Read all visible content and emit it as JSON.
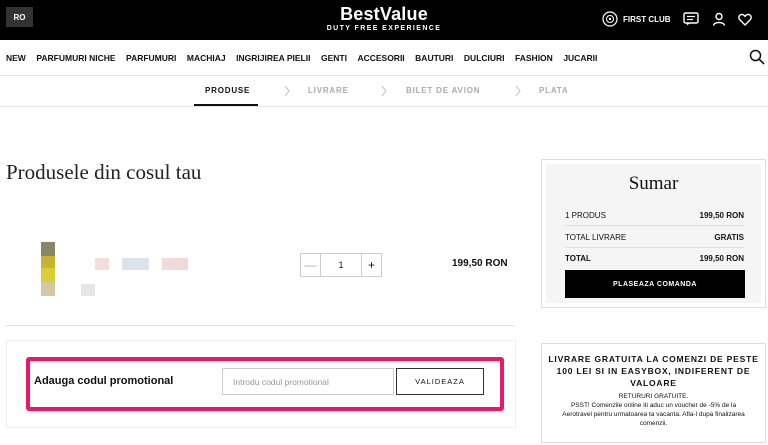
{
  "header": {
    "lang": "RO",
    "logo_main": "BestValue",
    "logo_tagline": "DUTY FREE EXPERIENCE",
    "first_club": "FIRST CLUB"
  },
  "nav": {
    "items": [
      "NEW",
      "PARFUMURI NICHE",
      "PARFUMURI",
      "MACHIAJ",
      "INGRIJIREA PIELII",
      "GENTI",
      "ACCESORII",
      "BAUTURI",
      "DULCIURI",
      "FASHION",
      "JUCARII"
    ]
  },
  "steps": [
    "PRODUSE",
    "LIVRARE",
    "BILET DE AVION",
    "PLATA"
  ],
  "cart": {
    "title": "Produsele din cosul tau",
    "quantity": "1",
    "minus": "—",
    "plus": "+",
    "price": "199,50 RON"
  },
  "promo": {
    "label": "Adauga codul promotional",
    "placeholder": "Introdu codul promotional",
    "button": "VALIDEAZA"
  },
  "summary": {
    "title": "Sumar",
    "rows": [
      {
        "label": "1 PRODUS",
        "value": "199,50 RON"
      },
      {
        "label": "TOTAL LIVRARE",
        "value": "GRATIS"
      },
      {
        "label": "TOTAL",
        "value": "199,50 RON"
      }
    ],
    "button": "PLASEAZA COMANDA"
  },
  "info": {
    "headline": "LIVRARE GRATUITA LA COMENZI DE PESTE 100 LEI SI IN EASYBOX, INDIFERENT DE VALOARE",
    "sub": "RETURURI GRATUITE.",
    "promo_text": "PSST! Comenzile online iti aduc un voucher de -5% de la Aerotravel pentru urmatoarea ta vacanta. Afla-l dupa finalizarea comenzii."
  },
  "colors": {
    "accent": "#ee1669",
    "topbar": "#000000"
  }
}
